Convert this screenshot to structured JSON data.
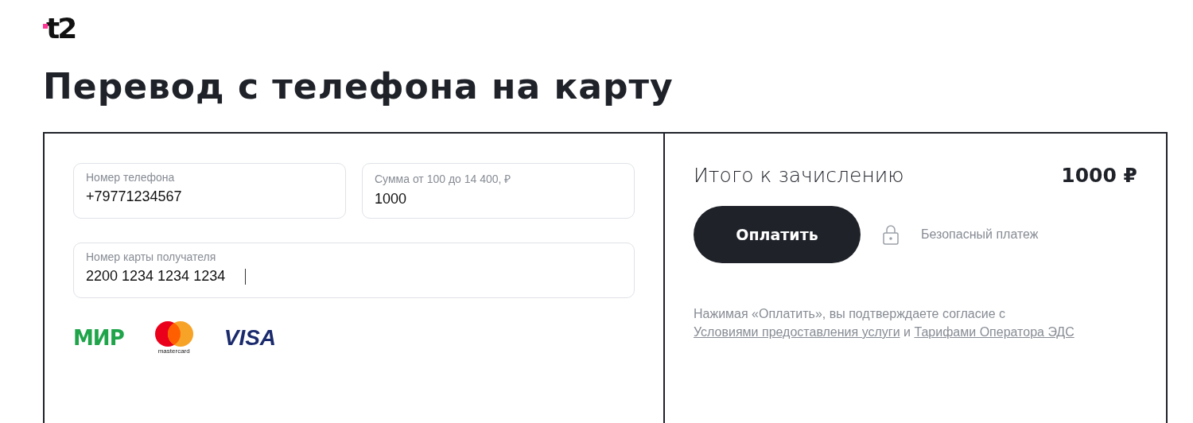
{
  "logo": {
    "text": "t2"
  },
  "title": "Перевод с телефона на карту",
  "form": {
    "fields": [
      {
        "label": "Номер телефона",
        "value": "+79771234567",
        "focused": false
      },
      {
        "label": "Сумма от 100 до 14 400, ₽",
        "value": "1000",
        "focused": false
      },
      {
        "label": "Номер карты получателя",
        "value": "2200 1234 1234 1234",
        "focused": true
      }
    ],
    "payment_systems": [
      {
        "kind": "mir",
        "text": "МИР"
      },
      {
        "kind": "mastercard",
        "text": "mastercard"
      },
      {
        "kind": "visa",
        "text": "VISA"
      }
    ]
  },
  "summary": {
    "label": "Итого к зачислению",
    "amount": "1000 ₽",
    "pay_button": "Оплатить",
    "secure_note": "Безопасный платеж",
    "consent": {
      "text": "Нажимая «Оплатить», вы подтверждаете согласие с",
      "link_1": "Условиями предоставления услуги",
      "joiner": "и",
      "link_2": "Тарифами Оператора ЭДС"
    }
  }
}
